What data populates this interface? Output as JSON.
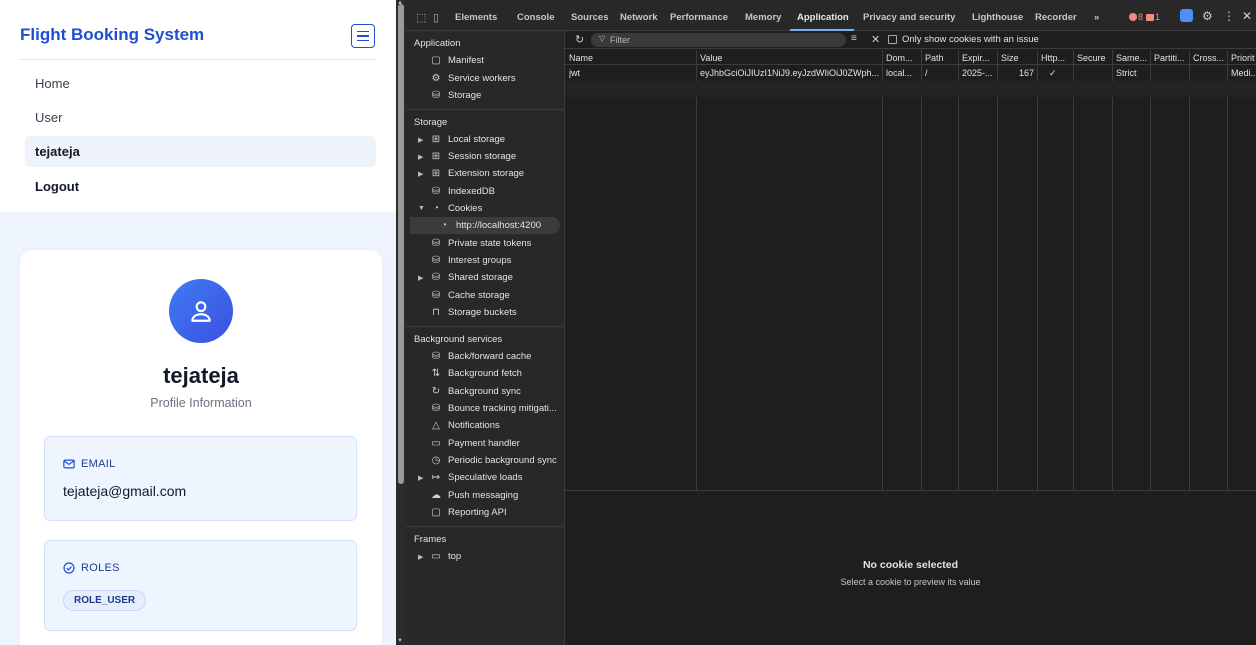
{
  "app": {
    "brand": "Flight Booking System",
    "nav": [
      "Home",
      "User",
      "tejateja",
      "Logout"
    ],
    "profile": {
      "name": "tejateja",
      "subtitle": "Profile Information",
      "email_label": "EMAIL",
      "email_value": "tejateja@gmail.com",
      "roles_label": "ROLES",
      "role_chip": "ROLE_USER"
    },
    "colors": {
      "brand": "#1f4fd1",
      "avatar": "#3b5ee8",
      "panel": "#eef4fd"
    }
  },
  "devtools": {
    "tabs": [
      "Elements",
      "Console",
      "Sources",
      "Network",
      "Performance",
      "Memory",
      "Application",
      "Privacy and security",
      "Lighthouse",
      "Recorder"
    ],
    "active_tab": "Application",
    "more_tabs": "»",
    "error_count": "8",
    "warning_count": "1",
    "sidebar": {
      "application_header": "Application",
      "application_items": [
        "Manifest",
        "Service workers",
        "Storage"
      ],
      "storage_header": "Storage",
      "storage_items": [
        "Local storage",
        "Session storage",
        "Extension storage",
        "IndexedDB",
        "Cookies",
        "http://localhost:4200",
        "Private state tokens",
        "Interest groups",
        "Shared storage",
        "Cache storage",
        "Storage buckets"
      ],
      "background_header": "Background services",
      "background_items": [
        "Back/forward cache",
        "Background fetch",
        "Background sync",
        "Bounce tracking mitigati...",
        "Notifications",
        "Payment handler",
        "Periodic background sync",
        "Speculative loads",
        "Push messaging",
        "Reporting API"
      ],
      "frames_header": "Frames",
      "frames_items": [
        "top"
      ]
    },
    "toolbar": {
      "filter_placeholder": "Filter",
      "only_issue_label": "Only show cookies with an issue"
    },
    "cookies": {
      "columns": [
        "Name",
        "Value",
        "Dom...",
        "Path",
        "Expir...",
        "Size",
        "Http...",
        "Secure",
        "Same...",
        "Partiti...",
        "Cross...",
        "Priorit"
      ],
      "rows": [
        [
          "jwt",
          "eyJhbGciOiJIUzI1NiJ9.eyJzdWIiOiJ0ZWph...",
          "local...",
          "/",
          "2025-...",
          "167",
          "✓",
          "",
          "Strict",
          "",
          "",
          "Medi..."
        ]
      ]
    },
    "preview": {
      "title": "No cookie selected",
      "subtitle": "Select a cookie to preview its value"
    }
  }
}
